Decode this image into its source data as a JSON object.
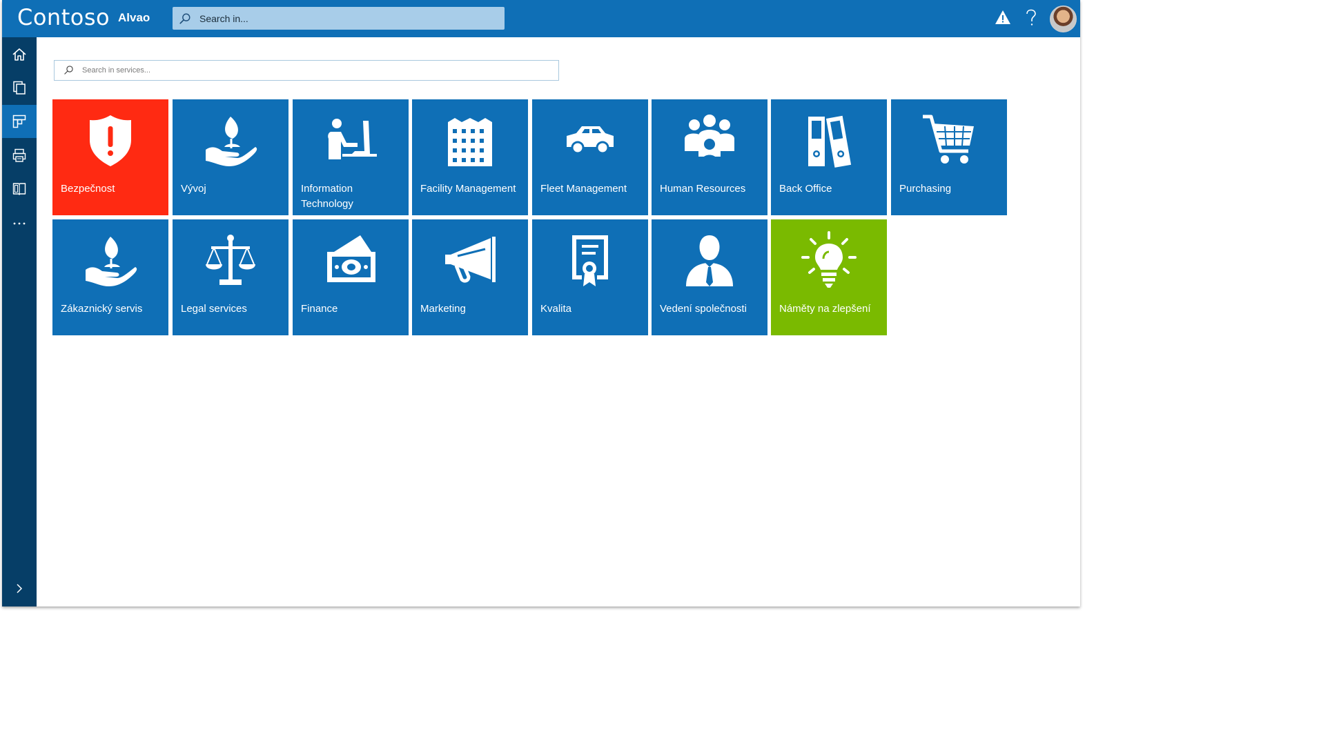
{
  "header": {
    "brand": "Contoso",
    "product": "Alvao",
    "search_placeholder": "Search in..."
  },
  "sidebar": {
    "items": [
      "home-icon",
      "documents-icon",
      "service-catalog-icon",
      "print-icon",
      "knowledge-base-icon",
      "more-icon"
    ],
    "expand_icon": "chevron-right-icon"
  },
  "main": {
    "search_placeholder": "Search in services..."
  },
  "colors": {
    "header": "#0f6fb6",
    "sidebar": "#063e67",
    "tile_default": "#0f6fb6",
    "tile_red": "#ff2a12",
    "tile_green": "#7aba00"
  },
  "tiles": [
    {
      "label": "Bezpečnost",
      "icon": "shield-alert-icon",
      "color": "#ff2a12"
    },
    {
      "label": "Vývoj",
      "icon": "hand-plant-icon",
      "color": "#0f6fb6"
    },
    {
      "label": "Information Technology",
      "icon": "person-computer-icon",
      "color": "#0f6fb6"
    },
    {
      "label": "Facility Management",
      "icon": "building-icon",
      "color": "#0f6fb6"
    },
    {
      "label": "Fleet Management",
      "icon": "car-icon",
      "color": "#0f6fb6"
    },
    {
      "label": "Human Resources",
      "icon": "people-group-icon",
      "color": "#0f6fb6"
    },
    {
      "label": "Back Office",
      "icon": "binders-icon",
      "color": "#0f6fb6"
    },
    {
      "label": "Purchasing",
      "icon": "shopping-cart-icon",
      "color": "#0f6fb6"
    },
    {
      "label": "Zákaznický servis",
      "icon": "hand-plant-icon",
      "color": "#0f6fb6"
    },
    {
      "label": "Legal services",
      "icon": "scales-icon",
      "color": "#0f6fb6"
    },
    {
      "label": "Finance",
      "icon": "money-icon",
      "color": "#0f6fb6"
    },
    {
      "label": "Marketing",
      "icon": "megaphone-icon",
      "color": "#0f6fb6"
    },
    {
      "label": "Kvalita",
      "icon": "certificate-icon",
      "color": "#0f6fb6"
    },
    {
      "label": "Vedení společnosti",
      "icon": "manager-icon",
      "color": "#0f6fb6"
    },
    {
      "label": "Náměty na zlepšení",
      "icon": "lightbulb-icon",
      "color": "#7aba00"
    }
  ]
}
